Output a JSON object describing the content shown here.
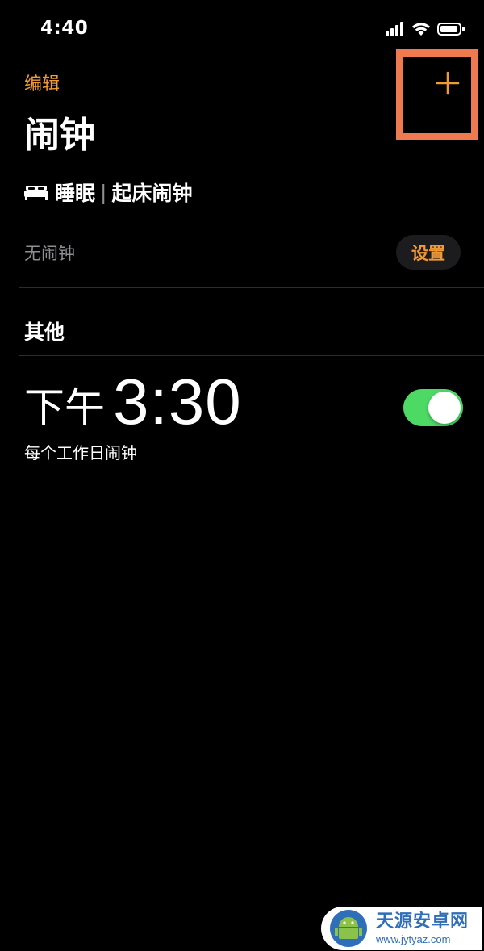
{
  "status_bar": {
    "time": "4:40",
    "signal_icon": "signal-bars-icon",
    "wifi_icon": "wifi-icon",
    "battery_icon": "battery-icon"
  },
  "nav": {
    "edit_label": "编辑",
    "add_icon": "plus-icon"
  },
  "title": "闹钟",
  "sleep": {
    "icon": "bed-icon",
    "label": "睡眠",
    "separator": "|",
    "subtitle": "起床闹钟",
    "status": "无闹钟",
    "set_label": "设置"
  },
  "other": {
    "title": "其他",
    "alarms": [
      {
        "period": "下午",
        "time": "3:30",
        "repeat": "每个工作日闹钟",
        "enabled": true
      }
    ]
  },
  "watermark": {
    "name": "天源安卓网",
    "url": "www.jytyaz.com"
  },
  "colors": {
    "accent": "#f09a37",
    "toggle_on": "#4cd964",
    "highlight": "#f07a4f",
    "background": "#000000"
  }
}
